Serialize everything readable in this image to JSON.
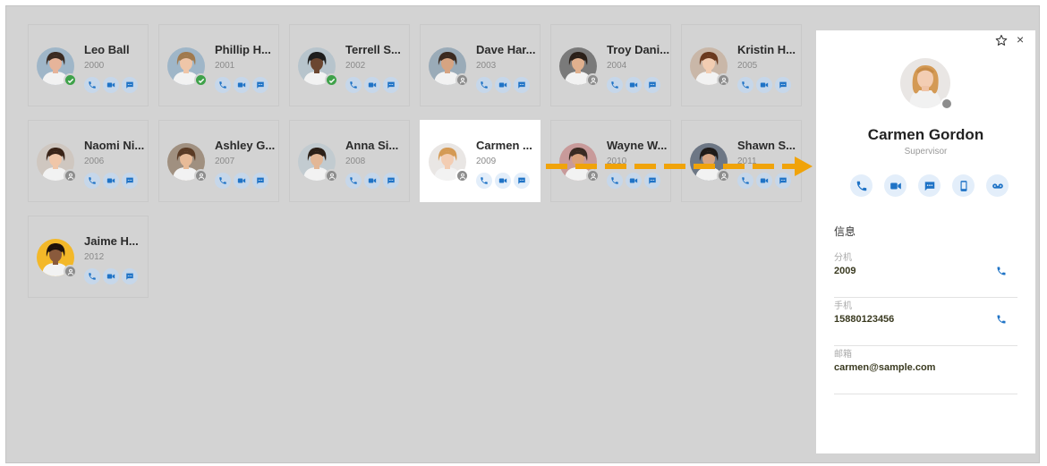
{
  "colors": {
    "accent": "#1f73c6",
    "available": "#3fa24a",
    "offline": "#8d8d8d",
    "arrow": "#f0a30a"
  },
  "contacts": [
    {
      "name": "Leo Ball",
      "ext": "2000",
      "status": "available"
    },
    {
      "name": "Phillip H...",
      "ext": "2001",
      "status": "available"
    },
    {
      "name": "Terrell S...",
      "ext": "2002",
      "status": "available"
    },
    {
      "name": "Dave Har...",
      "ext": "2003",
      "status": "offline"
    },
    {
      "name": "Troy Dani...",
      "ext": "2004",
      "status": "offline"
    },
    {
      "name": "Kristin H...",
      "ext": "2005",
      "status": "offline"
    },
    {
      "name": "Naomi Ni...",
      "ext": "2006",
      "status": "offline"
    },
    {
      "name": "Ashley G...",
      "ext": "2007",
      "status": "offline"
    },
    {
      "name": "Anna Si...",
      "ext": "2008",
      "status": "offline"
    },
    {
      "name": "Carmen ...",
      "ext": "2009",
      "status": "offline",
      "selected": true
    },
    {
      "name": "Wayne W...",
      "ext": "2010",
      "status": "offline"
    },
    {
      "name": "Shawn S...",
      "ext": "2011",
      "status": "offline"
    },
    {
      "name": "Jaime H...",
      "ext": "2012",
      "status": "offline"
    }
  ],
  "card_action_icons": [
    "phone-icon",
    "video-icon",
    "chat-icon"
  ],
  "detail": {
    "name": "Carmen Gordon",
    "role": "Supervisor",
    "action_icons": [
      "phone-icon",
      "video-icon",
      "chat-icon",
      "mobile-icon",
      "voicemail-icon"
    ],
    "section_title": "信息",
    "extension_label": "分机",
    "extension_value": "2009",
    "mobile_label": "手机",
    "mobile_value": "15880123456",
    "email_label": "邮箱",
    "email_value": "carmen@sample.com",
    "close_symbol": "×"
  }
}
